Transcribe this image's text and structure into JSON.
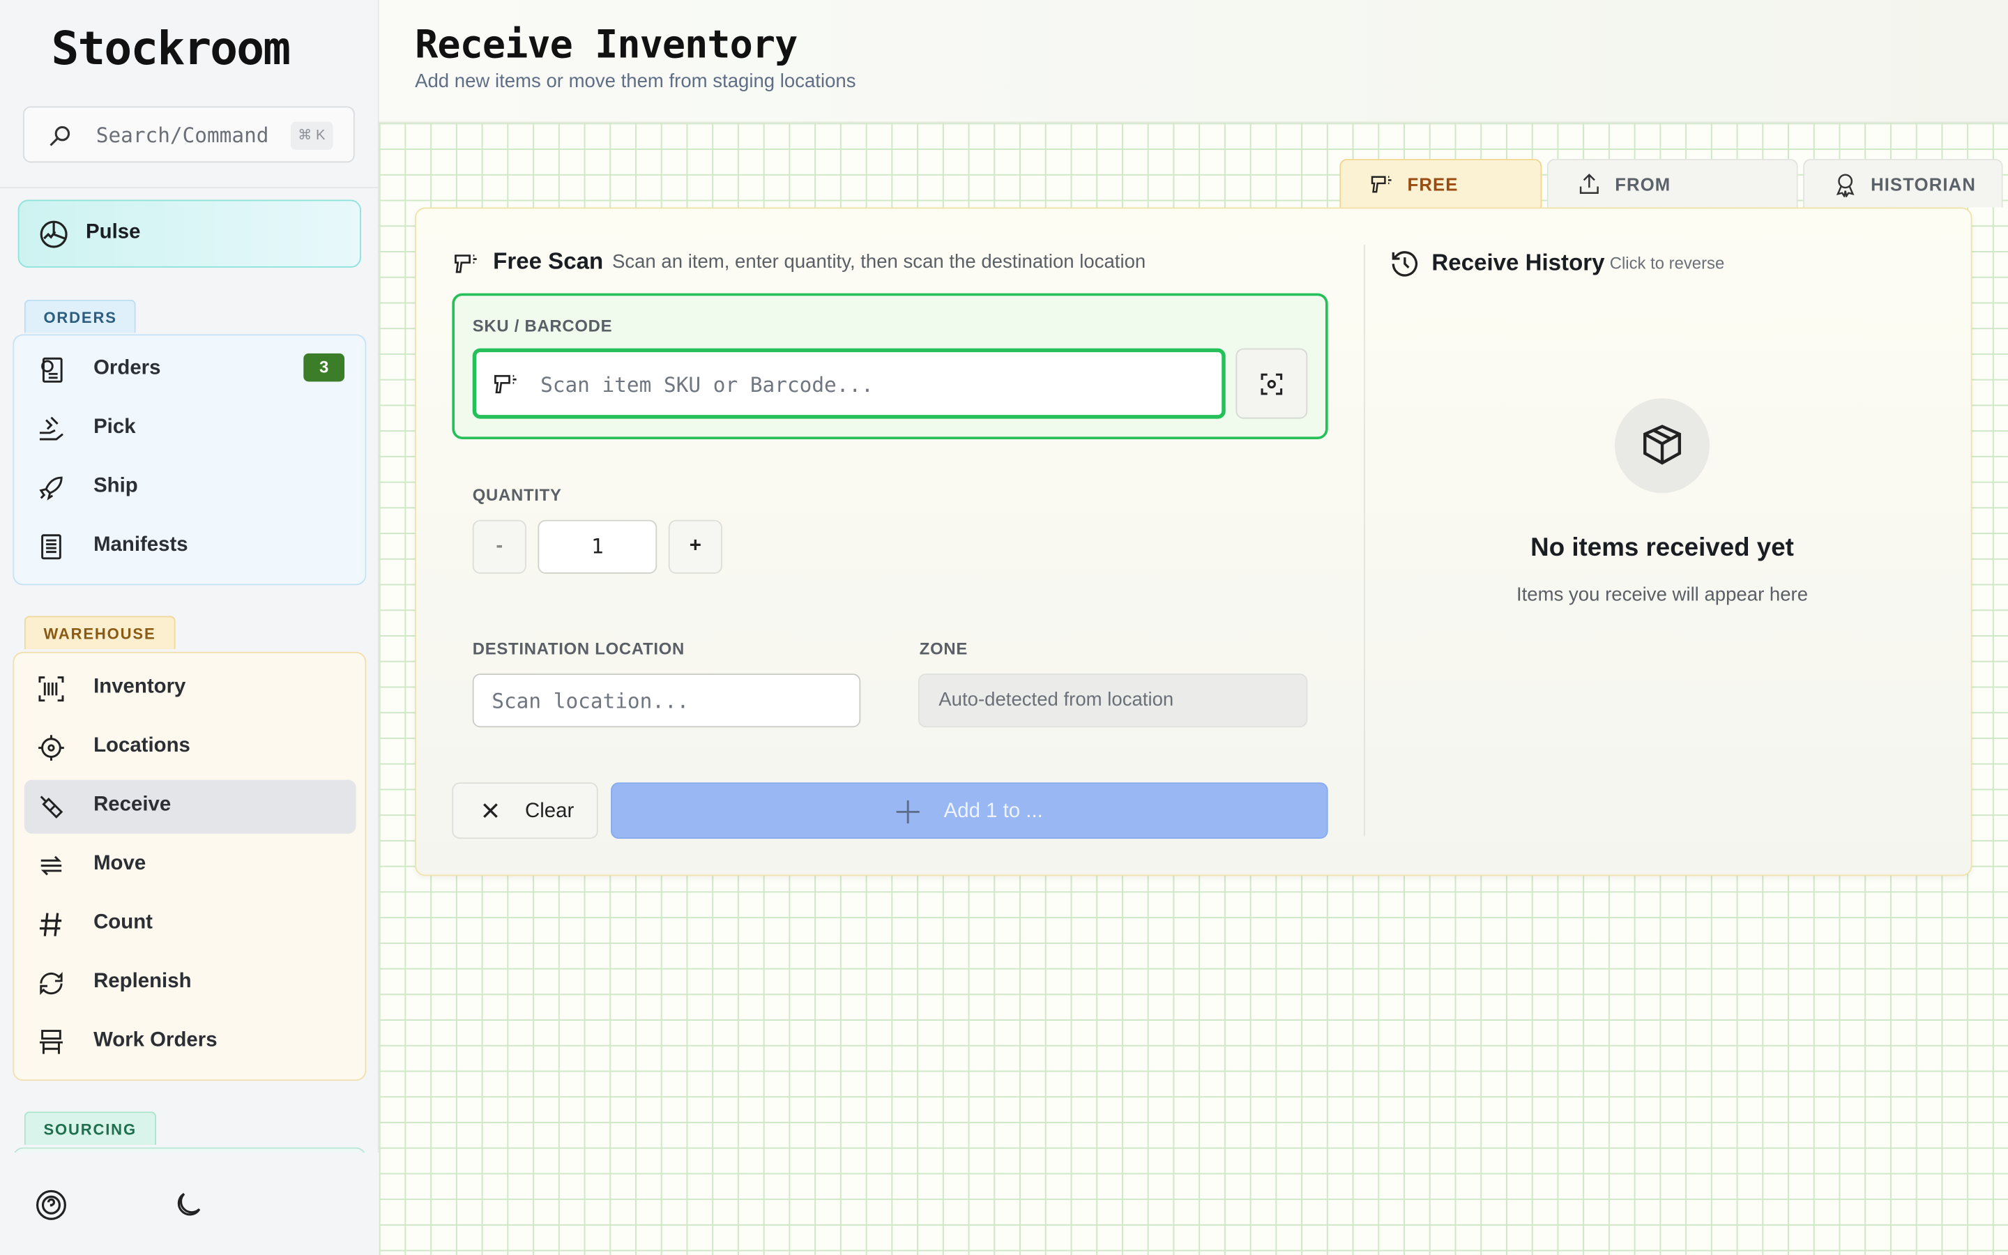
{
  "sidebar": {
    "brand": "Stockroom",
    "search": {
      "placeholder": "Search/Command",
      "shortcut": "⌘ K"
    },
    "pulse": {
      "label": "Pulse"
    },
    "sections": [
      {
        "tag": "ORDERS",
        "items": [
          {
            "label": "Orders",
            "icon": "orders-receipt-icon",
            "badge": "3"
          },
          {
            "label": "Pick",
            "icon": "hand-pick-icon"
          },
          {
            "label": "Ship",
            "icon": "rocket-icon"
          },
          {
            "label": "Manifests",
            "icon": "document-list-icon"
          }
        ]
      },
      {
        "tag": "WAREHOUSE",
        "items": [
          {
            "label": "Inventory",
            "icon": "barcode-scan-icon"
          },
          {
            "label": "Locations",
            "icon": "crosshair-icon"
          },
          {
            "label": "Receive",
            "icon": "hand-receive-icon",
            "active": true
          },
          {
            "label": "Move",
            "icon": "arrows-transfer-icon"
          },
          {
            "label": "Count",
            "icon": "hash-icon"
          },
          {
            "label": "Replenish",
            "icon": "cycle-icon"
          },
          {
            "label": "Work Orders",
            "icon": "workbench-icon"
          }
        ]
      },
      {
        "tag": "SOURCING",
        "items": []
      }
    ]
  },
  "header": {
    "title": "Receive Inventory",
    "subtitle": "Add new items or move them from staging locations"
  },
  "tabs": [
    {
      "label": "FREE SCAN",
      "icon": "scanner-gun-icon",
      "active": true
    },
    {
      "label": "FROM LOCATION",
      "icon": "upload-icon"
    },
    {
      "label": "HISTORIAN",
      "icon": "award-icon"
    }
  ],
  "free_scan": {
    "title": "Free Scan",
    "description": "Scan an item, enter quantity, then scan the destination location",
    "sku_label": "SKU / BARCODE",
    "sku_placeholder": "Scan item SKU or Barcode...",
    "quantity_label": "QUANTITY",
    "quantity_value": "1",
    "minus_label": "-",
    "plus_label": "+",
    "destination_label": "DESTINATION LOCATION",
    "destination_placeholder": "Scan location...",
    "zone_label": "ZONE",
    "zone_value": "Auto-detected from location",
    "clear_label": "Clear",
    "add_label": "Add 1 to ..."
  },
  "history": {
    "title": "Receive History",
    "hint": "Click to reverse",
    "empty_title": "No items received yet",
    "empty_subtitle": "Items you receive will appear here"
  },
  "colors": {
    "accent_green": "#26c05a",
    "badge_green": "#3c7d2a",
    "add_button_blue": "#98b7f3",
    "active_tab": "#fbf1d3"
  }
}
